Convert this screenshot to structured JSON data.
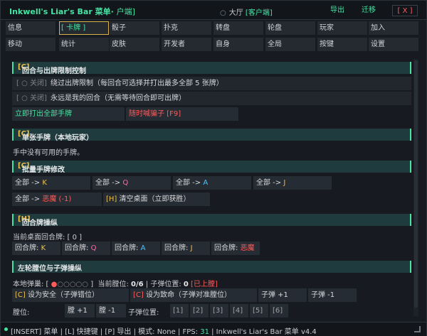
{
  "titlebar": {
    "title": "Inkwell's Liar's Bar 菜单",
    "title_suffix": "户端]",
    "hall_icon": "radio-empty-icon",
    "hall_label": "大厅",
    "hall_client": "[客户端]",
    "export": "导出",
    "migrate": "迁移",
    "close": "[ X ]"
  },
  "tabs": [
    "信息",
    "[ 卡牌 ]",
    "骰子",
    "扑克",
    "转盘",
    "轮盘",
    "玩家",
    "加入",
    "移动",
    "统计",
    "皮肤",
    "开发者",
    "自身",
    "全局",
    "按键",
    "设置"
  ],
  "sections": {
    "round_control": {
      "title": "回合与出牌限制控制",
      "key": "[C]"
    },
    "single_hand": {
      "title": "单张手牌（本地玩家）",
      "key": "[C]"
    },
    "batch_hand": {
      "title": "批量手牌修改",
      "key": "[C]"
    },
    "round_cards": {
      "title": "回合牌操纵",
      "key": "[H]"
    },
    "revolver": {
      "title": "左轮膛位与子弹操纵",
      "key": ""
    }
  },
  "round_control": {
    "toggle1": {
      "state": "[ ○ 关闭]",
      "label": "绕过出牌限制（每回合可选择并打出最多全部 5 张牌）"
    },
    "toggle2": {
      "state": "[ ○ 关闭]",
      "label": "永远是我的回合（无需等待回合即可出牌）"
    },
    "play_all": "立即打出全部手牌",
    "call_liar": "随时喊骗子 [F9]"
  },
  "single_hand": {
    "empty": "手中没有可用的手牌。"
  },
  "batch_hand": {
    "row1": [
      {
        "prefix": "全部 -> ",
        "value": "K"
      },
      {
        "prefix": "全部 -> ",
        "value": "Q"
      },
      {
        "prefix": "全部 -> ",
        "value": "A"
      },
      {
        "prefix": "全部 -> ",
        "value": "J"
      }
    ],
    "devil_prefix": "全部 -> ",
    "devil_value": "恶魔 (-1)",
    "clear_key": "[H]",
    "clear_label": " 清空桌面（立即获胜）"
  },
  "round_cards": {
    "current": "当前桌面回合牌: [ 0 ]",
    "buttons": [
      {
        "prefix": "回合牌: ",
        "value": "K"
      },
      {
        "prefix": "回合牌: ",
        "value": "Q"
      },
      {
        "prefix": "回合牌: ",
        "value": "A"
      },
      {
        "prefix": "回合牌: ",
        "value": "J"
      },
      {
        "prefix": "回合牌: ",
        "value": "恶魔"
      }
    ]
  },
  "revolver": {
    "bullets_prefix": "本地弹巢: [ ",
    "bullets_filled": "●",
    "bullets_empty": "○○○○○",
    "bullets_suffix": " ]",
    "current_chamber_label": "当前膛位: ",
    "current_chamber": "0/6",
    "bullet_pos_label": " | 子弹位置: ",
    "bullet_pos": "0",
    "loaded": "[已上膛]",
    "safe_key": "[C]",
    "safe_label": " 设为安全（子弹错位）",
    "deadly_key": "[C]",
    "deadly_label": " 设为致命（子弹对准膛位）",
    "bullet_plus": "子弹 +1",
    "bullet_minus": "子弹 -1",
    "chamber_label": "膛位:",
    "chamber_plus": "膛 +1",
    "chamber_minus": "膛 -1",
    "bullet_pos_row_label": "子弹位置:",
    "positions": [
      "[1]",
      "[2]",
      "[3]",
      "[4]",
      "[5]",
      "[6]"
    ]
  },
  "statusbar": {
    "text": "[INSERT] 菜单  |  [L] 快捷键  |  [P] 导出  |  模式: None  |  FPS: ",
    "fps": "31",
    "tail": "  |  Inkwell's Liar's Bar 菜单 v4.4"
  },
  "colors": {
    "accent": "#47e3a3",
    "key_yellow": "#f0c24a",
    "danger": "#ff5b5b",
    "card_k": "#f0c24a",
    "card_q": "#ff6aa6",
    "card_a": "#49c5ff",
    "card_j": "#ffb443"
  }
}
